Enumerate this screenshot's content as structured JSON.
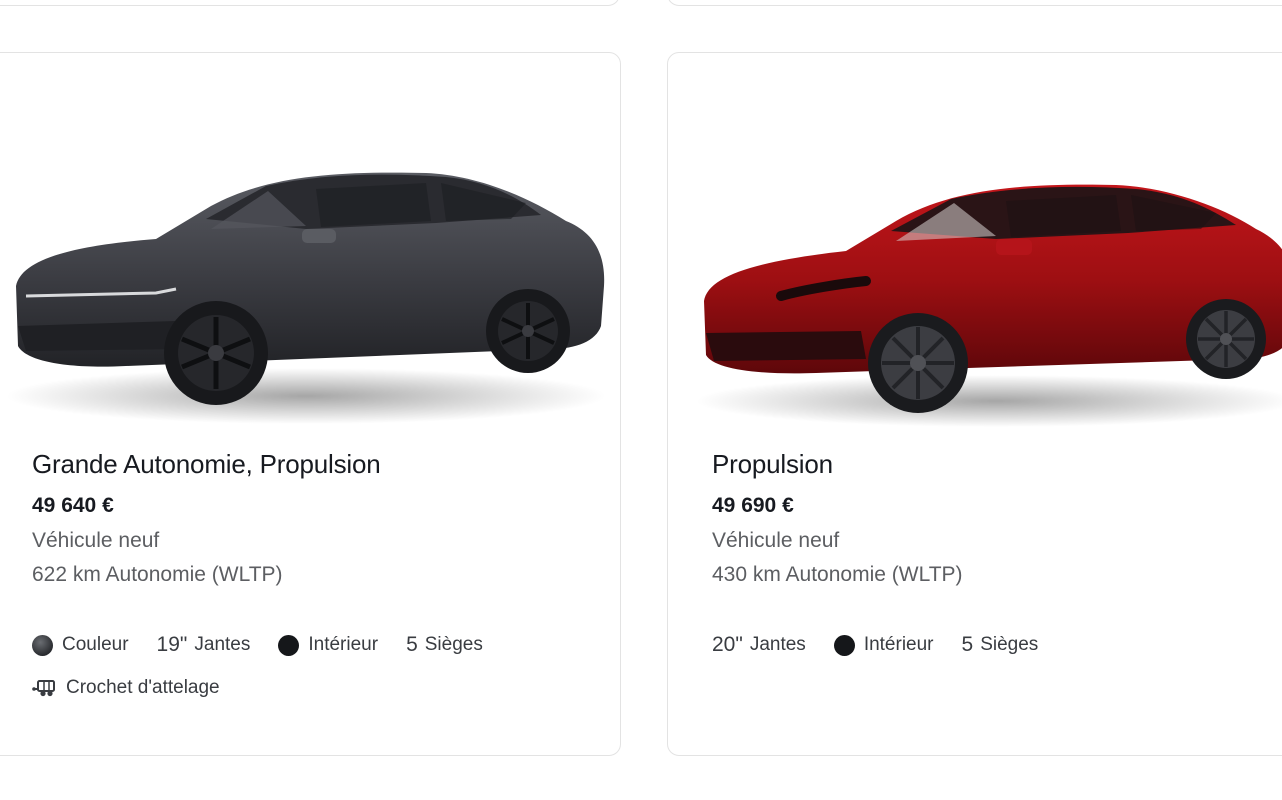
{
  "cards": [
    {
      "title": "Grande Autonomie, Propulsion",
      "price": "49 640 €",
      "condition": "Véhicule neuf",
      "range": "622 km Autonomie (WLTP)",
      "specs": {
        "color_label": "Couleur",
        "wheels_value": "19\"",
        "wheels_label": "Jantes",
        "interior_label": "Intérieur",
        "seats_value": "5",
        "seats_label": "Sièges"
      },
      "tow_label": "Crochet d'attelage",
      "paint_color": "#3c3d43"
    },
    {
      "title": "Propulsion",
      "price": "49 690 €",
      "condition": "Véhicule neuf",
      "range": "430 km Autonomie (WLTP)",
      "specs": {
        "wheels_value": "20\"",
        "wheels_label": "Jantes",
        "interior_label": "Intérieur",
        "seats_value": "5",
        "seats_label": "Sièges"
      },
      "paint_color": "#9e0f12"
    }
  ]
}
